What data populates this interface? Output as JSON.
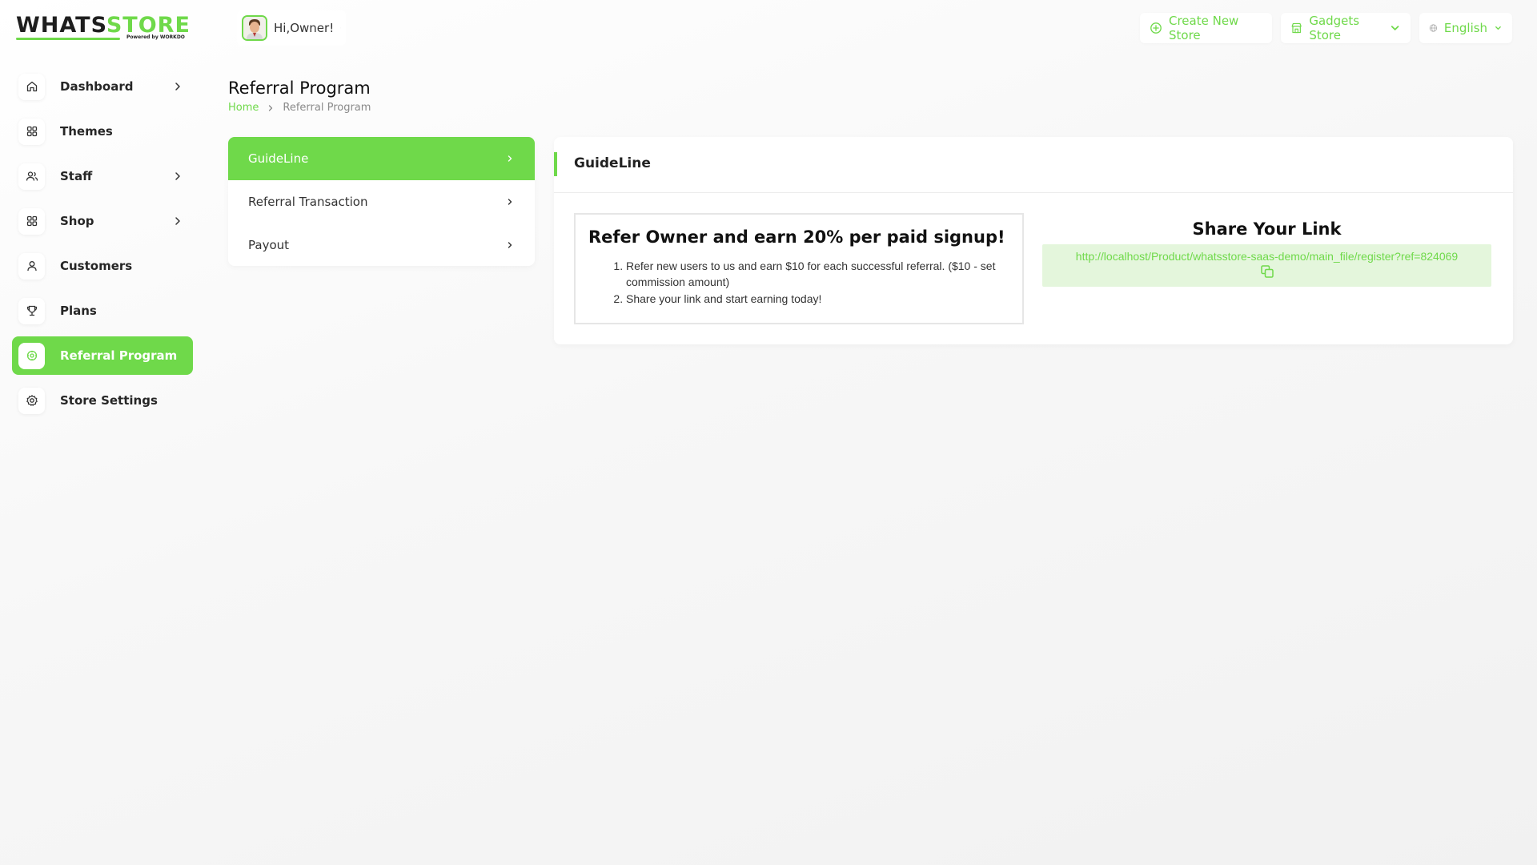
{
  "logo": {
    "part1": "WHATS",
    "part2": "STORE",
    "tagline": "Powered by WORKDO"
  },
  "user": {
    "greeting": "Hi,Owner!"
  },
  "topbar": {
    "create_store": "Create New Store",
    "store_name": "Gadgets Store",
    "language": "English"
  },
  "sidebar": {
    "items": [
      {
        "label": "Dashboard",
        "icon": "home-icon",
        "has_arrow": true
      },
      {
        "label": "Themes",
        "icon": "grid-icon",
        "has_arrow": false
      },
      {
        "label": "Staff",
        "icon": "users-icon",
        "has_arrow": true
      },
      {
        "label": "Shop",
        "icon": "grid-icon",
        "has_arrow": true
      },
      {
        "label": "Customers",
        "icon": "user-icon",
        "has_arrow": false
      },
      {
        "label": "Plans",
        "icon": "trophy-icon",
        "has_arrow": false
      },
      {
        "label": "Referral Program",
        "icon": "referral-icon",
        "has_arrow": false,
        "active": true
      },
      {
        "label": "Store Settings",
        "icon": "settings-icon",
        "has_arrow": false
      }
    ]
  },
  "page": {
    "title": "Referral Program",
    "breadcrumb": {
      "home": "Home",
      "current": "Referral Program"
    }
  },
  "tabs": [
    {
      "label": "GuideLine",
      "active": true
    },
    {
      "label": "Referral Transaction"
    },
    {
      "label": "Payout"
    }
  ],
  "card": {
    "title": "GuideLine",
    "refer_heading": "Refer Owner and earn 20% per paid signup!",
    "refer_points": [
      "Refer new users to us and earn $10 for each successful referral.  ($10 - set commission amount)",
      "Share your link and start earning today!"
    ],
    "share_title": "Share Your Link",
    "share_link": "http://localhost/Product/whatsstore-saas-demo/main_file/register?ref=824069"
  },
  "colors": {
    "accent": "#6fd94a",
    "accent_light": "#e4f6dc",
    "text": "#262626"
  }
}
